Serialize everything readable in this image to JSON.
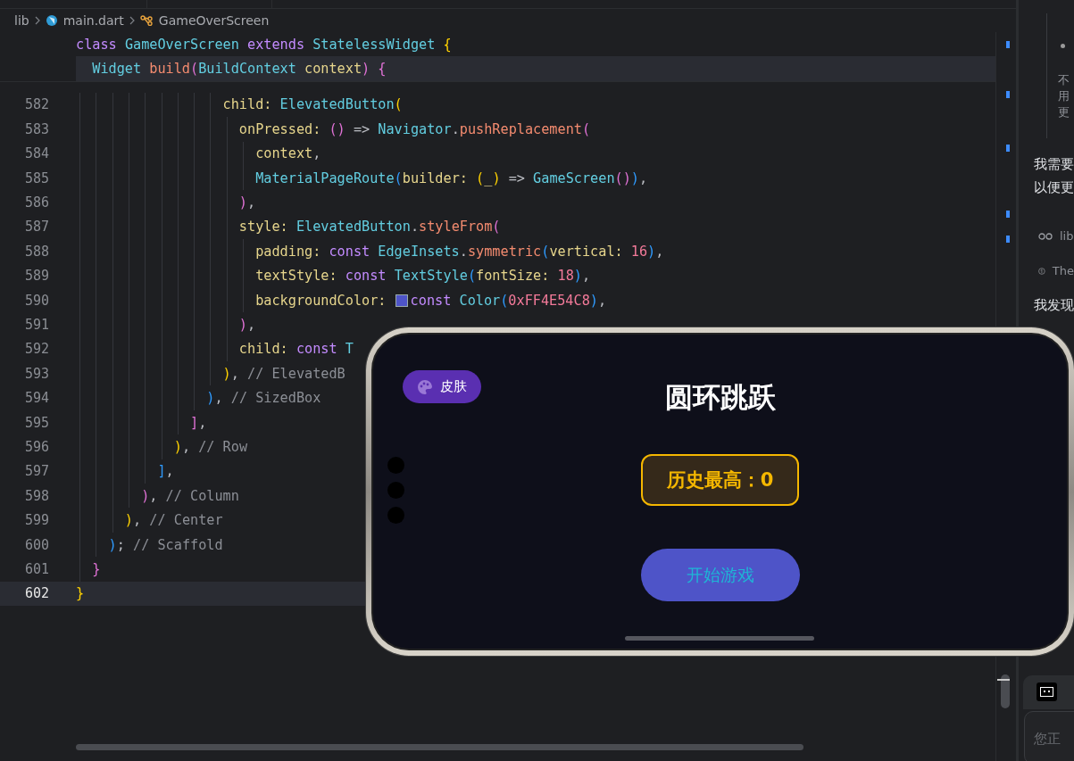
{
  "breadcrumbs": [
    {
      "kind": "folder",
      "label": "lib"
    },
    {
      "kind": "file",
      "label": "main.dart"
    },
    {
      "kind": "class",
      "label": "GameOverScreen"
    }
  ],
  "sticky_lines": [
    {
      "highlighted": false,
      "tokens": [
        {
          "kw": "class "
        },
        {
          "type": "GameOverScreen "
        },
        {
          "kw": "extends "
        },
        {
          "type": "StatelessWidget "
        },
        {
          "b1": "{"
        }
      ]
    },
    {
      "highlighted": true,
      "tokens": [
        {
          "type": "  Widget "
        },
        {
          "func": "build"
        },
        {
          "b2": "("
        },
        {
          "type": "BuildContext "
        },
        {
          "prop": "context"
        },
        {
          "b2": ") {"
        }
      ]
    }
  ],
  "code_lines": [
    {
      "number": "582",
      "current": false,
      "tokens": [
        {
          "prop": "                  child: "
        },
        {
          "type": "ElevatedButton"
        },
        {
          "b1": "("
        }
      ]
    },
    {
      "number": "583",
      "current": false,
      "tokens": [
        {
          "prop": "                    onPressed: "
        },
        {
          "b2": "()"
        },
        {
          "plain": " => "
        },
        {
          "type": "Navigator"
        },
        {
          "plain": "."
        },
        {
          "func": "pushReplacement"
        },
        {
          "b2": "("
        }
      ]
    },
    {
      "number": "584",
      "current": false,
      "tokens": [
        {
          "prop": "                      context"
        },
        {
          "plain": ","
        }
      ]
    },
    {
      "number": "585",
      "current": false,
      "tokens": [
        {
          "type": "                      MaterialPageRoute"
        },
        {
          "b3": "("
        },
        {
          "prop": "builder: "
        },
        {
          "b1": "("
        },
        {
          "prop": "_"
        },
        {
          "b1": ")"
        },
        {
          "plain": " => "
        },
        {
          "type": "GameScreen"
        },
        {
          "b2": "()"
        },
        {
          "b3": ")"
        },
        {
          "plain": ","
        }
      ]
    },
    {
      "number": "586",
      "current": false,
      "tokens": [
        {
          "b2": "                    )"
        },
        {
          "plain": ","
        }
      ]
    },
    {
      "number": "587",
      "current": false,
      "tokens": [
        {
          "prop": "                    style: "
        },
        {
          "type": "ElevatedButton"
        },
        {
          "plain": "."
        },
        {
          "func": "styleFrom"
        },
        {
          "b2": "("
        }
      ]
    },
    {
      "number": "588",
      "current": false,
      "tokens": [
        {
          "prop": "                      padding: "
        },
        {
          "kw": "const "
        },
        {
          "type": "EdgeInsets"
        },
        {
          "plain": "."
        },
        {
          "func": "symmetric"
        },
        {
          "b3": "("
        },
        {
          "prop": "vertical: "
        },
        {
          "num": "16"
        },
        {
          "b3": ")"
        },
        {
          "plain": ","
        }
      ]
    },
    {
      "number": "589",
      "current": false,
      "tokens": [
        {
          "prop": "                      textStyle: "
        },
        {
          "kw": "const "
        },
        {
          "type": "TextStyle"
        },
        {
          "b3": "("
        },
        {
          "prop": "fontSize: "
        },
        {
          "num": "18"
        },
        {
          "b3": ")"
        },
        {
          "plain": ","
        }
      ]
    },
    {
      "number": "590",
      "current": false,
      "tokens": [
        {
          "prop": "                      backgroundColor: "
        },
        {
          "color": "#4e54c8"
        },
        {
          "kw": "const "
        },
        {
          "type": "Color"
        },
        {
          "b3": "("
        },
        {
          "num": "0xFF4E54C8"
        },
        {
          "b3": ")"
        },
        {
          "plain": ","
        }
      ]
    },
    {
      "number": "591",
      "current": false,
      "tokens": [
        {
          "b2": "                    )"
        },
        {
          "plain": ","
        }
      ]
    },
    {
      "number": "592",
      "current": false,
      "tokens": [
        {
          "prop": "                    child: "
        },
        {
          "kw": "const "
        },
        {
          "type": "T"
        }
      ]
    },
    {
      "number": "593",
      "current": false,
      "tokens": [
        {
          "b1": "                  )"
        },
        {
          "plain": ", "
        },
        {
          "comment": "// ElevatedB"
        }
      ]
    },
    {
      "number": "594",
      "current": false,
      "tokens": [
        {
          "b3": "                )"
        },
        {
          "plain": ", "
        },
        {
          "comment": "// SizedBox"
        }
      ]
    },
    {
      "number": "595",
      "current": false,
      "tokens": [
        {
          "b2": "              ]"
        },
        {
          "plain": ","
        }
      ]
    },
    {
      "number": "596",
      "current": false,
      "tokens": [
        {
          "b1": "            )"
        },
        {
          "plain": ", "
        },
        {
          "comment": "// Row"
        }
      ]
    },
    {
      "number": "597",
      "current": false,
      "tokens": [
        {
          "b3": "          ]"
        },
        {
          "plain": ","
        }
      ]
    },
    {
      "number": "598",
      "current": false,
      "tokens": [
        {
          "b2": "        )"
        },
        {
          "plain": ", "
        },
        {
          "comment": "// Column"
        }
      ]
    },
    {
      "number": "599",
      "current": false,
      "tokens": [
        {
          "b1": "      )"
        },
        {
          "plain": ", "
        },
        {
          "comment": "// Center"
        }
      ]
    },
    {
      "number": "600",
      "current": false,
      "tokens": [
        {
          "b3": "    )"
        },
        {
          "plain": "; "
        },
        {
          "comment": "// Scaffold"
        }
      ]
    },
    {
      "number": "601",
      "current": false,
      "tokens": [
        {
          "b2": "  }"
        }
      ]
    },
    {
      "number": "602",
      "current": true,
      "tokens": [
        {
          "b1": "}"
        }
      ]
    }
  ],
  "chat_panel": {
    "quote_lines": [
      "不",
      "用",
      "更"
    ],
    "paragraph_lines": [
      "我需要",
      "以便更"
    ],
    "references": [
      {
        "kind": "file",
        "label": "lib"
      },
      {
        "kind": "info",
        "label": "The"
      }
    ],
    "finding": "我发现",
    "input": {
      "placeholder": "您正"
    }
  },
  "phone": {
    "skin_button": "皮肤",
    "title": "圆环跳跃",
    "best_score": "历史最高：0",
    "start_button": "开始游戏"
  }
}
